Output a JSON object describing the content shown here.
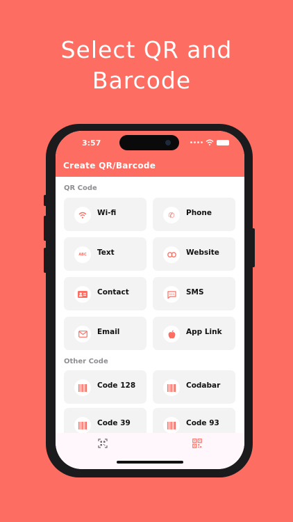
{
  "headline": {
    "line1": "Select QR and",
    "line2": "Barcode"
  },
  "status_bar": {
    "time": "3:57"
  },
  "app_bar": {
    "title": "Create QR/Barcode"
  },
  "sections": {
    "qr_code": {
      "label": "QR Code",
      "items": [
        {
          "label": "Wi-fi",
          "icon": "wifi-icon"
        },
        {
          "label": "Phone",
          "icon": "phone-icon"
        },
        {
          "label": "Text",
          "icon": "text-icon"
        },
        {
          "label": "Website",
          "icon": "link-icon"
        },
        {
          "label": "Contact",
          "icon": "contact-card-icon"
        },
        {
          "label": "SMS",
          "icon": "message-icon"
        },
        {
          "label": "Email",
          "icon": "email-icon"
        },
        {
          "label": "App Link",
          "icon": "apple-icon"
        }
      ]
    },
    "other_code": {
      "label": "Other Code",
      "items": [
        {
          "label": "Code 128",
          "icon": "barcode-icon"
        },
        {
          "label": "Codabar",
          "icon": "barcode-icon"
        },
        {
          "label": "Code 39",
          "icon": "barcode-icon"
        },
        {
          "label": "Code 93",
          "icon": "barcode-icon"
        }
      ]
    }
  },
  "bottom_nav": [
    {
      "icon": "scan-icon"
    },
    {
      "icon": "qr-code-icon"
    }
  ],
  "colors": {
    "accent": "#fe6d61",
    "card": "#f3f3f3",
    "nav_bg": "#fff7fb"
  }
}
